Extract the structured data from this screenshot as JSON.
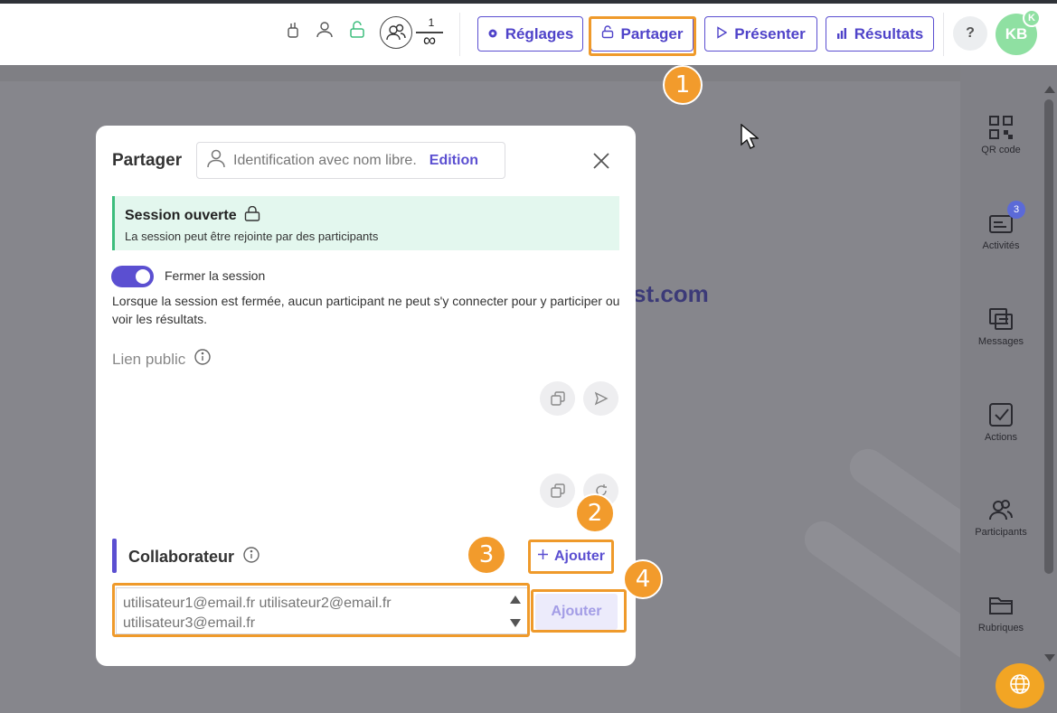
{
  "topbar": {
    "participant_count": "1",
    "participant_limit": "∞",
    "buttons": {
      "settings": "Réglages",
      "share": "Partager",
      "present": "Présenter",
      "results": "Résultats"
    },
    "help_label": "?",
    "avatar_initials": "KB",
    "avatar_badge": "K"
  },
  "slide": {
    "url_fragment": "st.com"
  },
  "sidebar": {
    "items": [
      {
        "label": "QR code",
        "icon": "qr-code-icon"
      },
      {
        "label": "Activités",
        "icon": "activities-icon",
        "badge": "3"
      },
      {
        "label": "Messages",
        "icon": "messages-icon"
      },
      {
        "label": "Actions",
        "icon": "actions-icon"
      },
      {
        "label": "Participants",
        "icon": "participants-icon"
      },
      {
        "label": "Rubriques",
        "icon": "folder-icon"
      }
    ]
  },
  "modal": {
    "title": "Partager",
    "identification_text": "Identification avec nom libre.",
    "identification_edit": "Edition",
    "session_title": "Session ouverte",
    "session_desc": "La session peut être rejointe par des participants",
    "toggle_label": "Fermer la session",
    "toggle_desc": "Lorsque la session est fermée, aucun participant ne peut s'y connecter pour y participer ou voir les résultats.",
    "public_link_label": "Lien public",
    "collaborator_label": "Collaborateur",
    "add_link": "Ajouter",
    "emails_placeholder": "utilisateur1@email.fr utilisateur2@email.fr utilisateur3@email.fr",
    "add_button": "Ajouter"
  },
  "annotations": {
    "markers": [
      "1",
      "2",
      "3",
      "4"
    ]
  },
  "colors": {
    "accent": "#5b4fd1",
    "annotation": "#f29b2c",
    "session_bg": "#e3f7ee",
    "session_border": "#3dbd7d"
  }
}
